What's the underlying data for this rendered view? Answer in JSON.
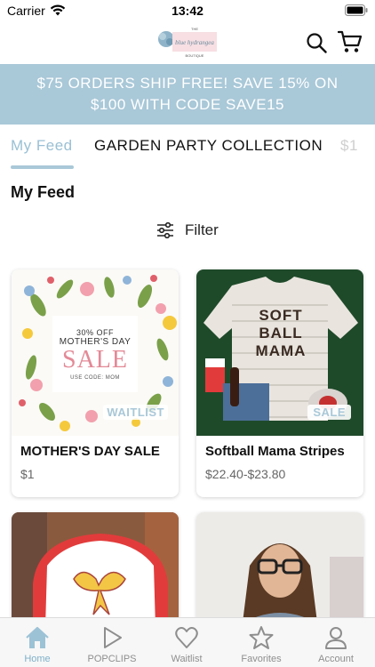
{
  "status_bar": {
    "carrier": "Carrier",
    "time": "13:42"
  },
  "header": {
    "logo_top": "THE",
    "logo_name": "blue hydrangea",
    "logo_sub": "BOUTIQUE"
  },
  "banner": {
    "text": "$75 ORDERS SHIP FREE! SAVE 15% ON $100 WITH CODE SAVE15"
  },
  "tabs": [
    {
      "label": "My Feed",
      "active": true
    },
    {
      "label": "GARDEN PARTY COLLECTION",
      "active": false
    },
    {
      "label": "$1",
      "active": false
    }
  ],
  "feed": {
    "title": "My Feed",
    "filter_label": "Filter"
  },
  "products": [
    {
      "title": "MOTHER'S DAY SALE",
      "price": "$1",
      "badge": "WAITLIST",
      "image_text": {
        "line1": "30% OFF",
        "line2": "MOTHER'S DAY",
        "line3": "SALE",
        "line4": "USE CODE: MOM"
      }
    },
    {
      "title": "Softball Mama Stripes",
      "price": "$22.40-$23.80",
      "badge": "SALE",
      "image_text": {
        "line1": "SOFT",
        "line2": "BALL",
        "line3": "MAMA"
      }
    },
    {
      "title": "",
      "price": ""
    },
    {
      "title": "",
      "price": ""
    }
  ],
  "tabbar": [
    {
      "label": "Home",
      "icon": "home-icon",
      "active": true
    },
    {
      "label": "POPCLIPS",
      "icon": "play-icon",
      "active": false
    },
    {
      "label": "Waitlist",
      "icon": "heart-icon",
      "active": false
    },
    {
      "label": "Favorites",
      "icon": "star-icon",
      "active": false
    },
    {
      "label": "Account",
      "icon": "person-icon",
      "active": false
    }
  ],
  "colors": {
    "accent": "#a9c8d8",
    "active_tab": "#7fb0c8",
    "text": "#111111"
  }
}
